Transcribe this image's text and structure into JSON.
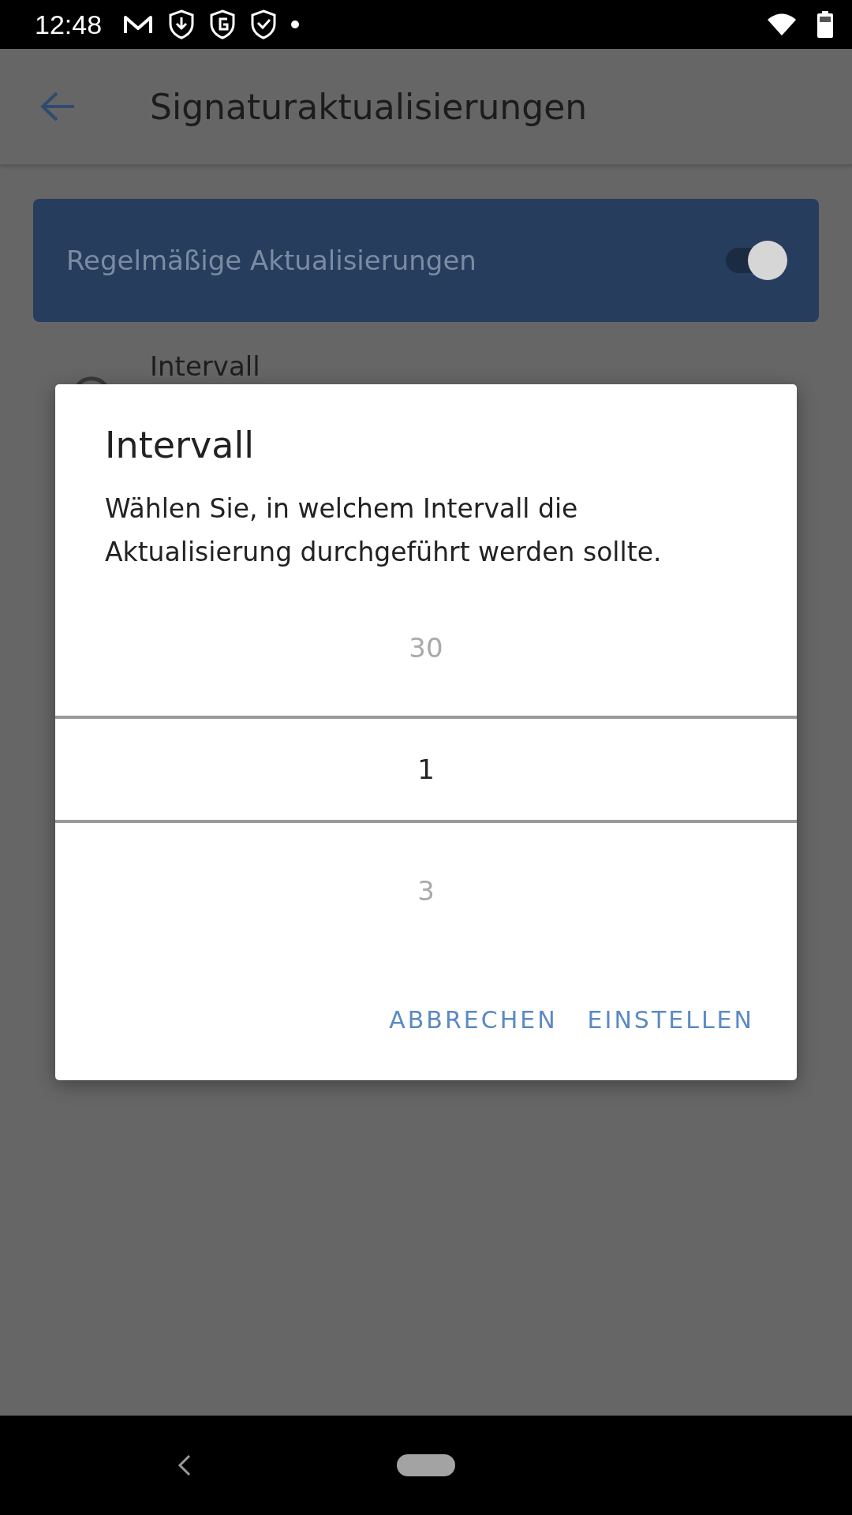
{
  "status_bar": {
    "time": "12:48"
  },
  "app_bar": {
    "title": "Signaturaktualisierungen"
  },
  "toggle_card": {
    "label": "Regelmäßige Aktualisierungen",
    "on": true
  },
  "setting": {
    "title": "Intervall"
  },
  "dialog": {
    "title": "Intervall",
    "message": "Wählen Sie, in welchem Intervall die Aktualisierung durchgeführt werden sollte.",
    "picker": [
      {
        "label": "30",
        "selected": false
      },
      {
        "label": "1",
        "selected": true
      },
      {
        "label": "3",
        "selected": false
      }
    ],
    "buttons": [
      "ABBRECHEN",
      "EINSTELLEN"
    ]
  }
}
